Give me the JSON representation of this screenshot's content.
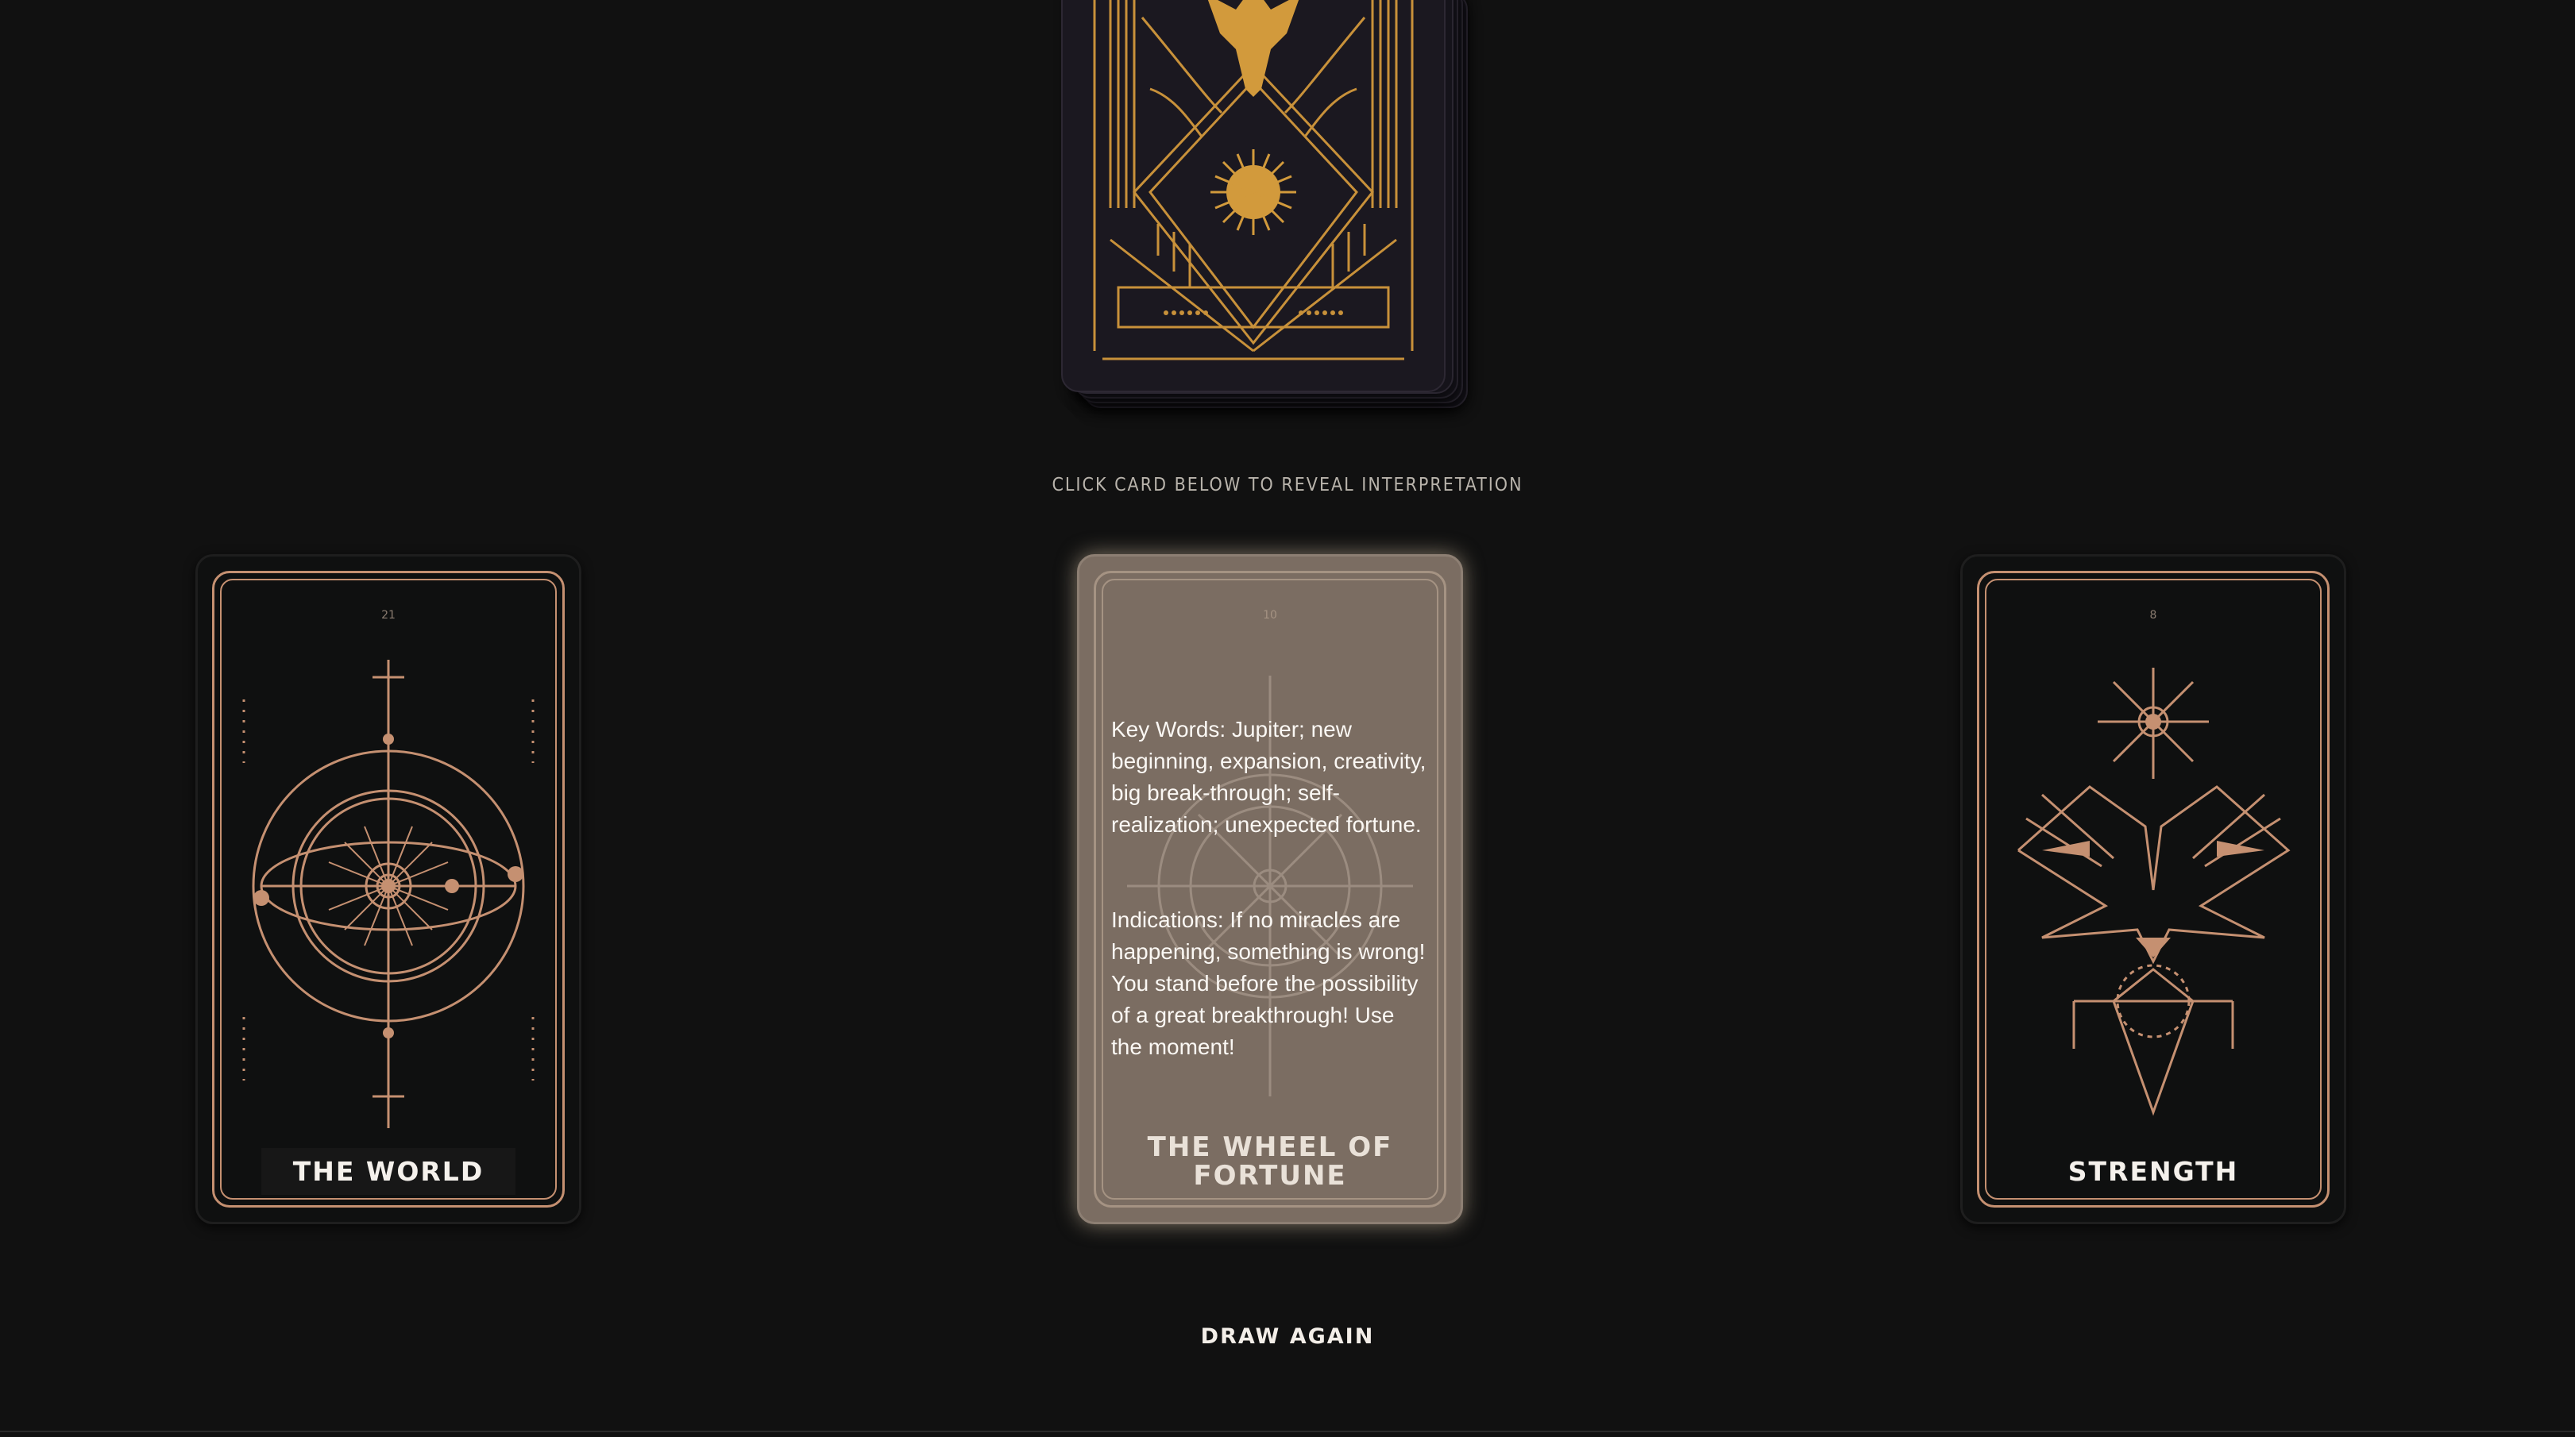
{
  "instruction": "CLICK CARD BELOW TO REVEAL INTERPRETATION",
  "cards": [
    {
      "number": "21",
      "title": "THE WORLD"
    },
    {
      "number": "10",
      "title": "THE WHEEL OF FORTUNE",
      "interpretation": {
        "keywords": "Key Words: Jupiter; new beginning, expansion, creativity, big break-through; self-realization; unexpected fortune.",
        "indications": "Indications: If no miracles are happening, something is wrong! You stand before the possibility of a great breakthrough! Use the moment!"
      }
    },
    {
      "number": "8",
      "title": "STRENGTH"
    }
  ],
  "draw_again": "DRAW AGAIN",
  "colors": {
    "background": "#111111",
    "accent": "#c59071",
    "gold": "#d29a3c"
  }
}
